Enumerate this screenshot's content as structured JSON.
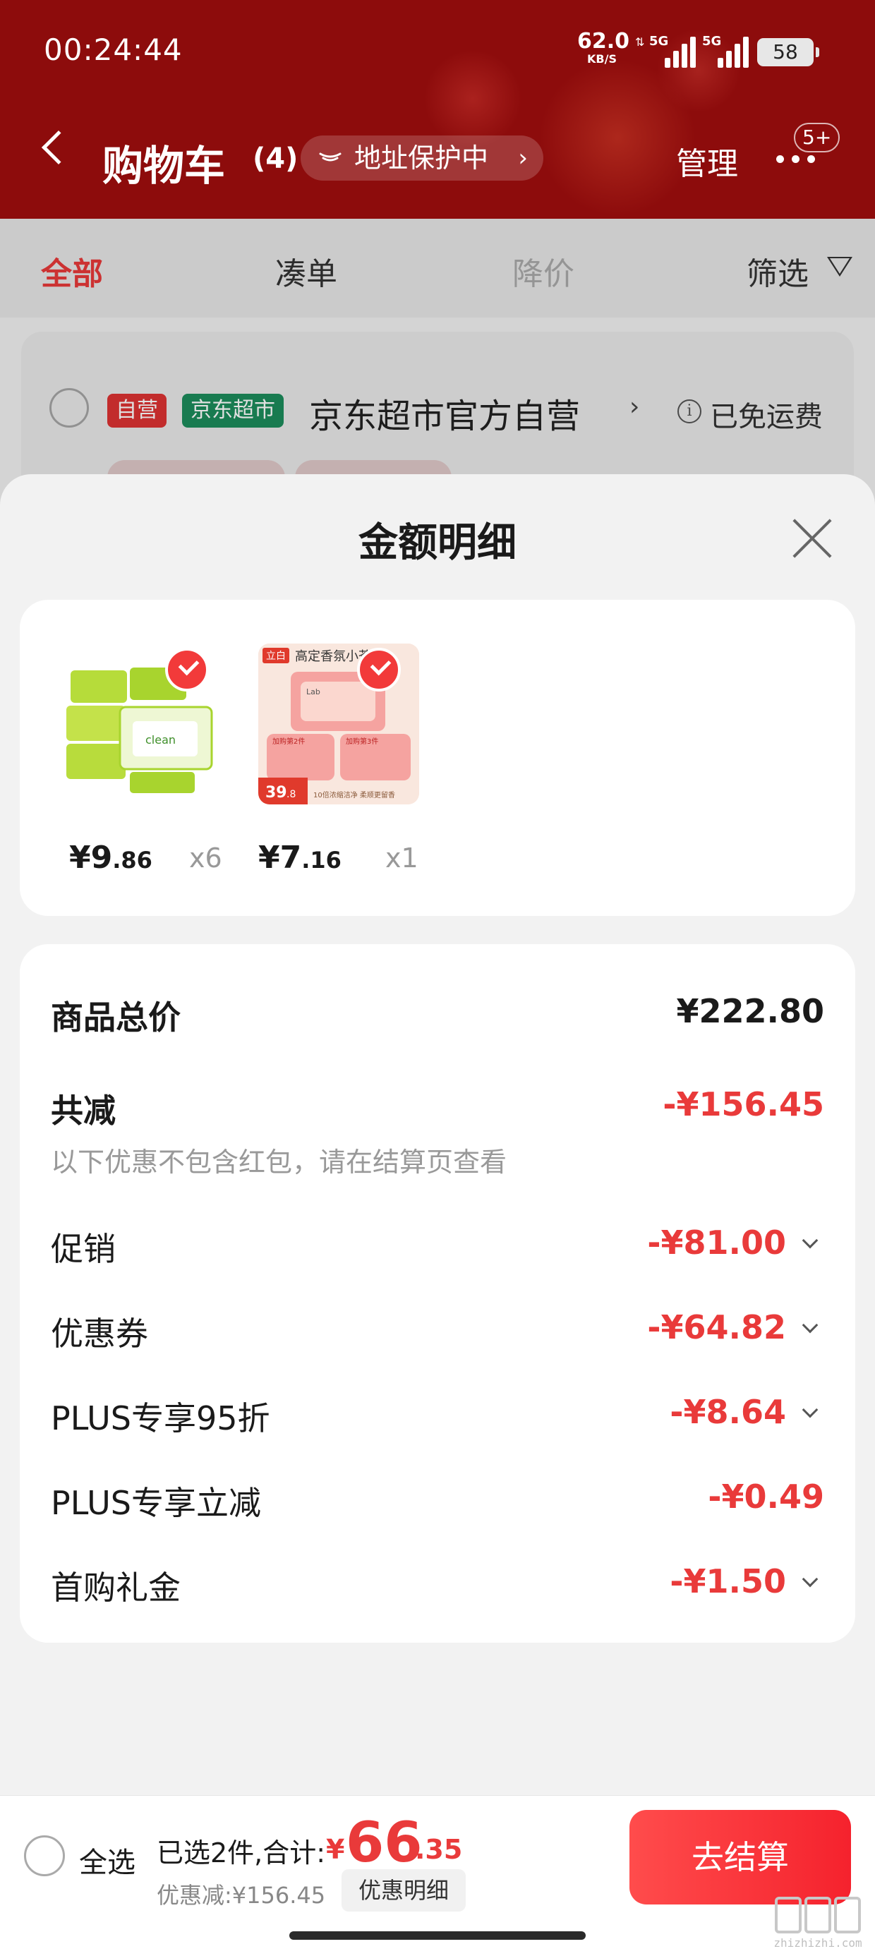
{
  "status_bar": {
    "time": "00:24:44",
    "net_speed": "62.0",
    "net_unit": "KB/S",
    "signal1_label": "5G",
    "signal2_label": "5G",
    "battery": "58"
  },
  "header": {
    "title": "购物车",
    "count": "(4)",
    "address_pill": "地址保护中",
    "manage": "管理",
    "message_badge": "5+",
    "bg_color": "#8d0c0c"
  },
  "tabs": [
    {
      "label": "全部",
      "active": true
    },
    {
      "label": "凑单"
    },
    {
      "label": "降价"
    },
    {
      "label": "筛选"
    }
  ],
  "store": {
    "tag_self": "自营",
    "tag_market": "京东超市",
    "name": "京东超市官方自营",
    "shipping": "已免运费",
    "info_icon": "i"
  },
  "sheet": {
    "title": "金额明细",
    "products": [
      {
        "price_int": "¥9",
        "price_dec": ".86",
        "qty": "x6",
        "icon": "tissue-pack-image"
      },
      {
        "price_int": "¥7",
        "price_dec": ".16",
        "qty": "x1",
        "icon": "laundry-pods-image"
      }
    ],
    "product2_image_text": {
      "brand": "立白",
      "headline": "高定香氛小苍兰",
      "badge": "39",
      "badge_dec": ".8",
      "footer": "10倍浓缩洁净 柔顺更留香",
      "box1": "加购第2件",
      "box2": "加购第3件"
    },
    "product1_image_text": {
      "brand": "clean"
    },
    "summary": {
      "goods_total_label": "商品总价",
      "goods_total_value": "¥222.80",
      "reduced_label": "共减",
      "reduced_value": "-¥156.45",
      "note": "以下优惠不包含红包，请在结算页查看"
    },
    "items": [
      {
        "label": "促销",
        "value": "-¥81.00",
        "expandable": true
      },
      {
        "label": "优惠券",
        "value": "-¥64.82",
        "expandable": true
      },
      {
        "label": "PLUS专享95折",
        "value": "-¥8.64",
        "expandable": true
      },
      {
        "label": "PLUS专享立减",
        "value": "-¥0.49",
        "expandable": false
      },
      {
        "label": "首购礼金",
        "value": "-¥1.50",
        "expandable": true
      }
    ]
  },
  "bottom_bar": {
    "select_all": "全选",
    "selected_text": "已选2件,合计:",
    "total_symbol": "¥",
    "total_int": "66",
    "total_dec": ".35",
    "saved_text": "优惠减:¥156.45",
    "detail_button": "优惠明细",
    "checkout_button": "去结算"
  },
  "watermark": "zhizhizhi.com",
  "colors": {
    "accent_red": "#e93a3a",
    "checkout_red": "#f5222d",
    "header_red": "#8d0c0c"
  }
}
